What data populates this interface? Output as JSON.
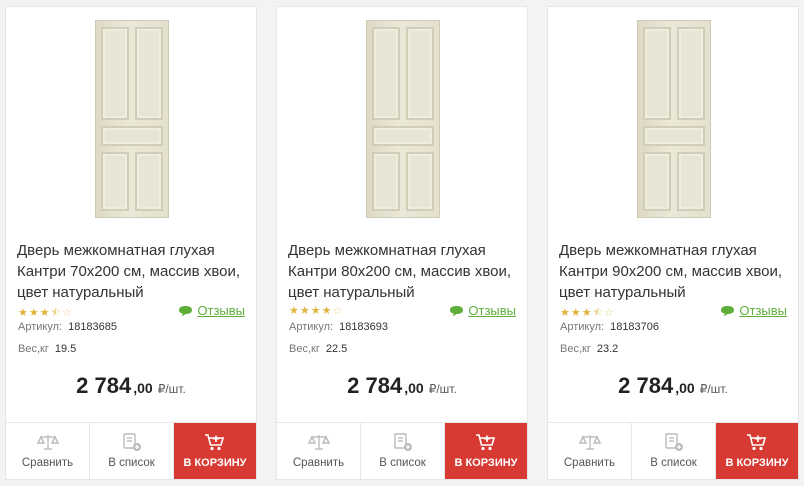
{
  "products": [
    {
      "title": "Дверь межкомнатная глухая Кантри 70x200 см, массив хвои, цвет натуральный",
      "rating": 3.5,
      "reviews_label": "Отзывы",
      "sku_label": "Артикул:",
      "sku": "18183685",
      "weight_label": "Вес,кг",
      "weight": "19.5",
      "price_int": "2 784",
      "price_dec": ",00",
      "price_unit": "₽/шт.",
      "compare_label": "Сравнить",
      "list_label": "В список",
      "cart_label": "В КОРЗИНУ"
    },
    {
      "title": "Дверь межкомнатная глухая Кантри 80x200 см, массив хвои, цвет натуральный",
      "rating": 4,
      "reviews_label": "Отзывы",
      "sku_label": "Артикул:",
      "sku": "18183693",
      "weight_label": "Вес,кг",
      "weight": "22.5",
      "price_int": "2 784",
      "price_dec": ",00",
      "price_unit": "₽/шт.",
      "compare_label": "Сравнить",
      "list_label": "В список",
      "cart_label": "В КОРЗИНУ"
    },
    {
      "title": "Дверь межкомнатная глухая Кантри 90x200 см, массив хвои, цвет натуральный",
      "rating": 3.5,
      "reviews_label": "Отзывы",
      "sku_label": "Артикул:",
      "sku": "18183706",
      "weight_label": "Вес,кг",
      "weight": "23.2",
      "price_int": "2 784",
      "price_dec": ",00",
      "price_unit": "₽/шт.",
      "compare_label": "Сравнить",
      "list_label": "В список",
      "cart_label": "В КОРЗИНУ"
    }
  ],
  "icons": {
    "compare": "scales-icon",
    "list": "list-add-icon",
    "cart": "cart-add-icon",
    "reviews": "chat-bubble-icon"
  },
  "colors": {
    "accent_red": "#d63a32",
    "link_green": "#5fae3a",
    "star": "#e0b43a"
  }
}
